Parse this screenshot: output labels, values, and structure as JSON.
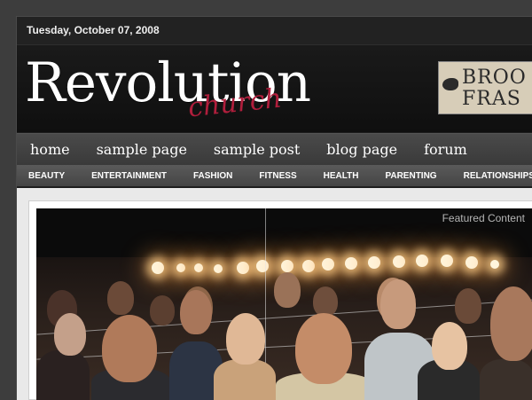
{
  "date": "Tuesday, October 07, 2008",
  "logo": {
    "title": "Revolution",
    "subtitle": "church"
  },
  "ad": {
    "line1": "BROO",
    "line2": "FRAS"
  },
  "main_nav": [
    {
      "label": "home"
    },
    {
      "label": "sample page"
    },
    {
      "label": "sample post"
    },
    {
      "label": "blog page"
    },
    {
      "label": "forum"
    }
  ],
  "category_nav": [
    {
      "label": "BEAUTY"
    },
    {
      "label": "ENTERTAINMENT"
    },
    {
      "label": "FASHION"
    },
    {
      "label": "FITNESS"
    },
    {
      "label": "HEALTH"
    },
    {
      "label": "PARENTING"
    },
    {
      "label": "RELATIONSHIPS"
    }
  ],
  "featured": {
    "label": "Featured Content"
  },
  "colors": {
    "accent": "#b01e3c",
    "background": "#3d3d3d",
    "content_bg": "#e9e9e9"
  }
}
